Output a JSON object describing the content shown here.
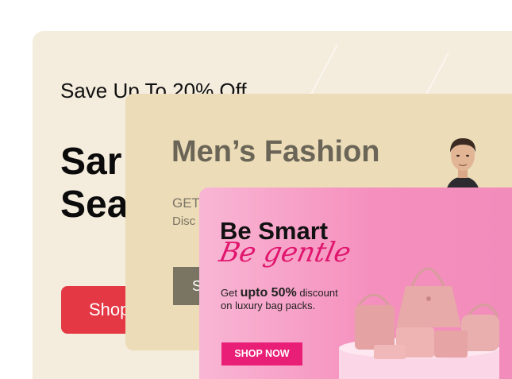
{
  "banner_back": {
    "pretitle": "Save Up To 20% Off",
    "title": "Sar\nSea",
    "button": "Shop"
  },
  "banner_mens": {
    "title": "Men’s Fashion",
    "subtitle": "GET",
    "desc": "Disc",
    "button": "S"
  },
  "banner_bags": {
    "title": "Be Smart",
    "script": "Be gentle",
    "desc_pre": "Get ",
    "desc_strong": "upto 50%",
    "desc_post": " discount",
    "desc_line2": "on luxury bag packs.",
    "button": "SHOP NOW"
  },
  "colors": {
    "back_bg": "#f4ecdc",
    "back_button": "#e53845",
    "mens_bg": "#ecdcb8",
    "bags_accent": "#e91e77"
  }
}
